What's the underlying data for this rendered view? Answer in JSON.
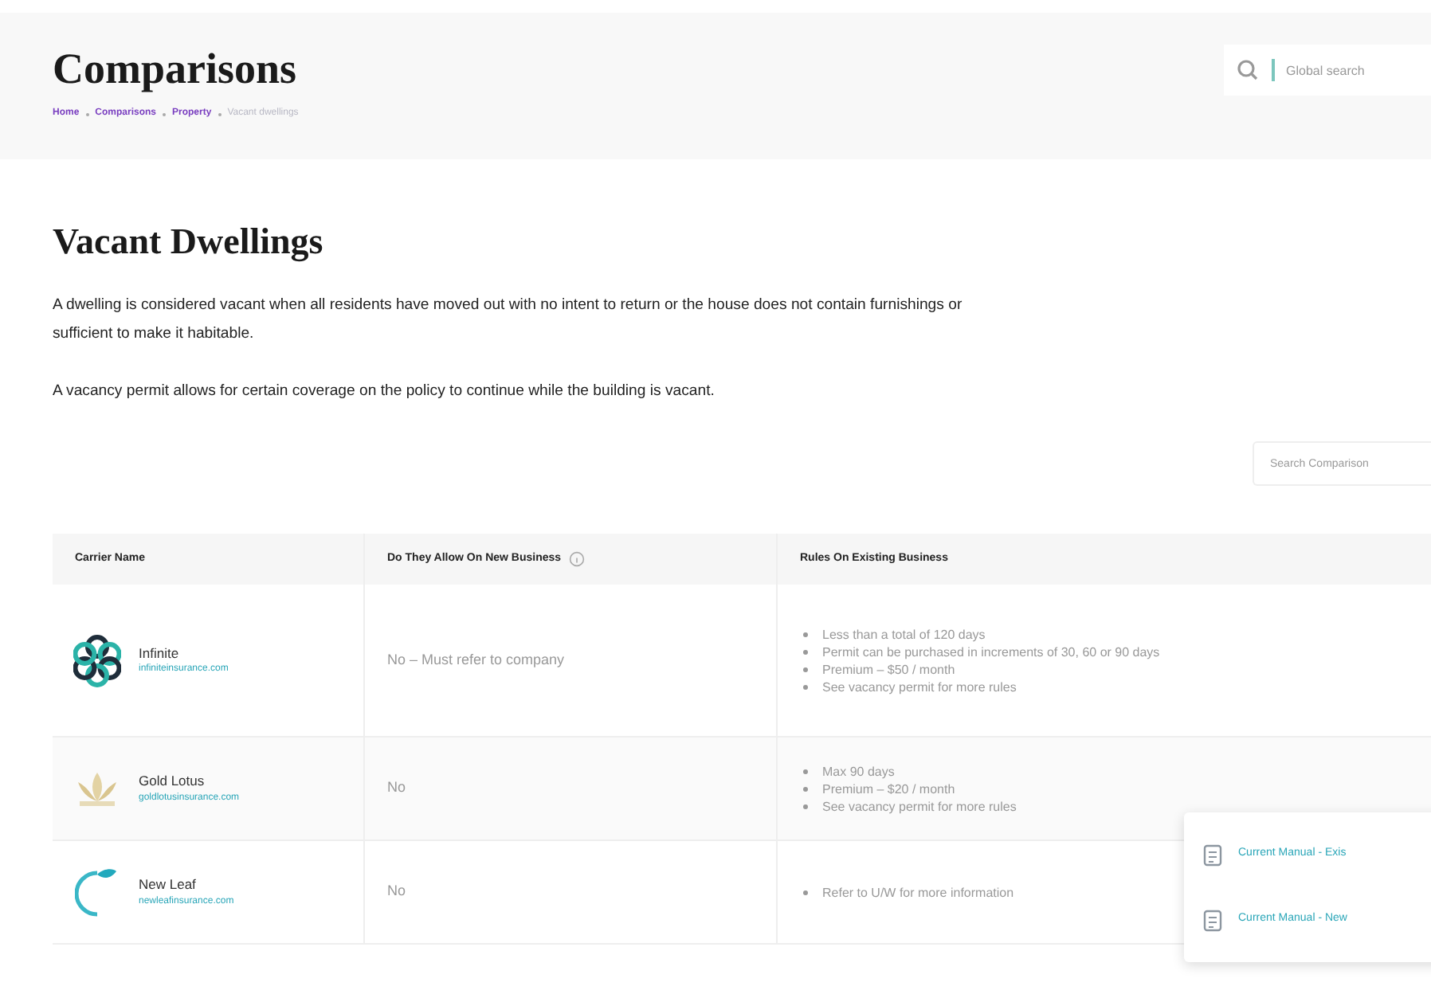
{
  "header": {
    "title": "Comparisons",
    "breadcrumbs": [
      {
        "label": "Home",
        "current": false
      },
      {
        "label": "Comparisons",
        "current": false
      },
      {
        "label": "Property",
        "current": false
      },
      {
        "label": "Vacant dwellings",
        "current": true
      }
    ],
    "search": {
      "placeholder": "Global search"
    }
  },
  "section": {
    "title": "Vacant Dwellings",
    "paragraphs": [
      "A dwelling is considered vacant when all residents have moved out with no intent to return or the house does not contain furnishings or",
      "sufficient to make it habitable.",
      "A vacancy permit allows for certain coverage on the policy to continue while the building is vacant."
    ]
  },
  "table_search": {
    "placeholder": "Search Comparison"
  },
  "table": {
    "columns": [
      "Carrier Name",
      "Do They Allow On New Business",
      "Rules On Existing Business"
    ],
    "rows": [
      {
        "kind": "flower",
        "name": "Infinite",
        "site": "infiniteinsurance.com",
        "new_business": "No – Must refer to company",
        "rules": [
          "Less than a total of 120 days",
          "Permit can be purchased in increments of 30, 60 or 90 days",
          "Premium – $50 / month",
          "See vacancy permit for more rules"
        ]
      },
      {
        "kind": "lotus",
        "name": "Gold Lotus",
        "site": "goldlotusinsurance.com",
        "new_business": "No",
        "rules": [
          "Max 90 days",
          "Premium – $20 / month",
          "See vacancy permit for more rules"
        ]
      },
      {
        "kind": "leaf",
        "name": "New Leaf",
        "site": "newleafinsurance.com",
        "new_business": "No",
        "rules": [
          "Refer to U/W for more information"
        ]
      }
    ]
  },
  "documents_menu": {
    "items": [
      "Current Manual - Exis",
      "Current Manual - New"
    ]
  }
}
